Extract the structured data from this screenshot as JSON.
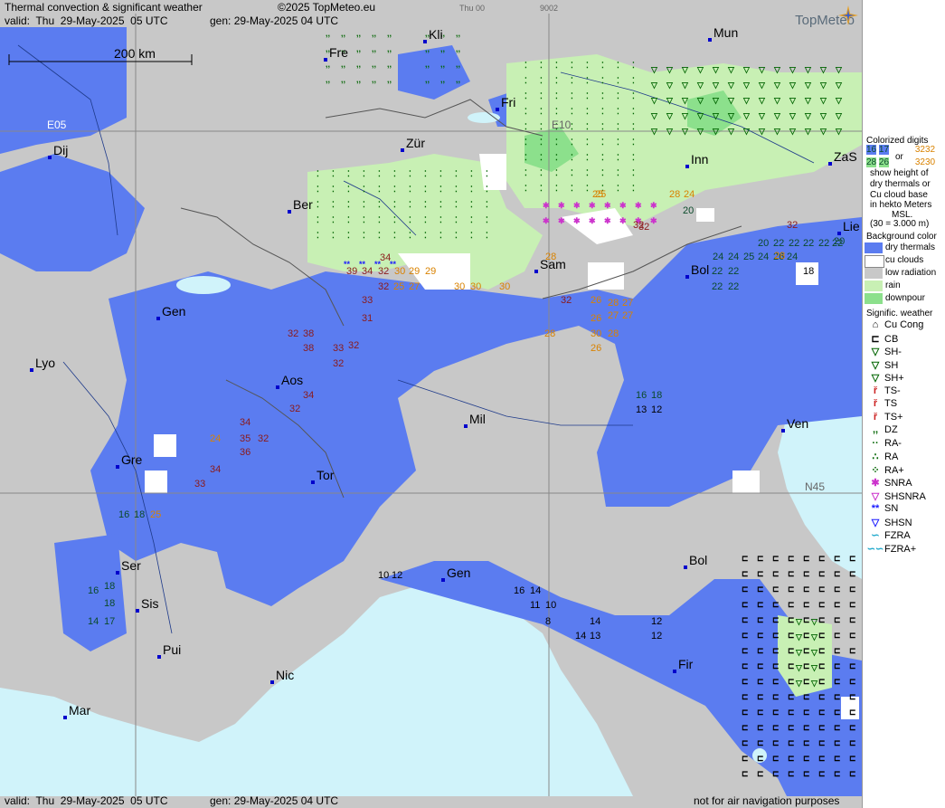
{
  "header": {
    "title": "Thermal convection & significant weather",
    "copyright": "©2025 TopMeteo.eu",
    "valid": "valid:  Thu  29-May-2025  05 UTC",
    "gen": "gen: 29-May-2025 04 UTC",
    "day_code": "Thu 00",
    "code": "9002",
    "brand": "TopMeteo",
    "scale": "200 km"
  },
  "footer": {
    "valid": "valid:  Thu  29-May-2025  05 UTC",
    "gen": "gen: 29-May-2025 04 UTC",
    "note": "not for air navigation purposes"
  },
  "grid_labels": {
    "e05": "E05",
    "e10": "E10",
    "n45": "N45"
  },
  "cities": [
    {
      "id": "kli",
      "name": "Kli"
    },
    {
      "id": "mun",
      "name": "Mun"
    },
    {
      "id": "fre",
      "name": "Fre"
    },
    {
      "id": "fri",
      "name": "Fri"
    },
    {
      "id": "dij",
      "name": "Dij"
    },
    {
      "id": "zur",
      "name": "Zür"
    },
    {
      "id": "inn",
      "name": "Inn"
    },
    {
      "id": "zas",
      "name": "ZaS"
    },
    {
      "id": "ber",
      "name": "Ber"
    },
    {
      "id": "lie",
      "name": "Lie"
    },
    {
      "id": "sam",
      "name": "Sam"
    },
    {
      "id": "bol1",
      "name": "Bol"
    },
    {
      "id": "gen1",
      "name": "Gen"
    },
    {
      "id": "lyo",
      "name": "Lyo"
    },
    {
      "id": "aos",
      "name": "Aos"
    },
    {
      "id": "mil",
      "name": "Mil"
    },
    {
      "id": "ven",
      "name": "Ven"
    },
    {
      "id": "gre",
      "name": "Gre"
    },
    {
      "id": "tor",
      "name": "Tor"
    },
    {
      "id": "ser",
      "name": "Ser"
    },
    {
      "id": "gen2",
      "name": "Gen"
    },
    {
      "id": "bol2",
      "name": "Bol"
    },
    {
      "id": "sis",
      "name": "Sis"
    },
    {
      "id": "pui",
      "name": "Pui"
    },
    {
      "id": "nic",
      "name": "Nic"
    },
    {
      "id": "fir",
      "name": "Fir"
    },
    {
      "id": "mar",
      "name": "Mar"
    }
  ],
  "thermal_numbers": [
    {
      "t": "39",
      "c": "#8b1a1a"
    },
    {
      "t": "34",
      "c": "#8b1a1a"
    },
    {
      "t": "32",
      "c": "#8b1a1a"
    },
    {
      "t": "30",
      "c": "#d98200"
    },
    {
      "t": "29",
      "c": "#d98200"
    },
    {
      "t": "30",
      "c": "#d98200"
    },
    {
      "t": "30",
      "c": "#d98200"
    },
    {
      "t": "30",
      "c": "#d98200"
    },
    {
      "t": "29",
      "c": "#d98200"
    },
    {
      "t": "34",
      "c": "#8b1a1a"
    },
    {
      "t": "25",
      "c": "#d98200"
    },
    {
      "t": "27",
      "c": "#d98200"
    },
    {
      "t": "33",
      "c": "#8b1a1a"
    },
    {
      "t": "32",
      "c": "#8b1a1a"
    },
    {
      "t": "31",
      "c": "#8b1a1a"
    },
    {
      "t": "38",
      "c": "#8b1a1a"
    },
    {
      "t": "38",
      "c": "#8b1a1a"
    },
    {
      "t": "33",
      "c": "#8b1a1a"
    },
    {
      "t": "32",
      "c": "#8b1a1a"
    },
    {
      "t": "32",
      "c": "#8b1a1a"
    },
    {
      "t": "32",
      "c": "#8b1a1a"
    },
    {
      "t": "34",
      "c": "#8b1a1a"
    },
    {
      "t": "28",
      "c": "#d98200"
    },
    {
      "t": "32",
      "c": "#8b1a1a"
    },
    {
      "t": "26",
      "c": "#d98200"
    },
    {
      "t": "28",
      "c": "#d98200"
    },
    {
      "t": "27",
      "c": "#d98200"
    },
    {
      "t": "26",
      "c": "#d98200"
    },
    {
      "t": "27",
      "c": "#d98200"
    },
    {
      "t": "27",
      "c": "#d98200"
    },
    {
      "t": "30",
      "c": "#d98200"
    },
    {
      "t": "28",
      "c": "#d98200"
    },
    {
      "t": "26",
      "c": "#d98200"
    },
    {
      "t": "28",
      "c": "#d98200"
    },
    {
      "t": "32",
      "c": "#8b1a1a"
    },
    {
      "t": "28",
      "c": "#d98200"
    },
    {
      "t": "24",
      "c": "#d98200"
    },
    {
      "t": "25",
      "c": "#d98200"
    },
    {
      "t": "34",
      "c": "#8b1a1a"
    },
    {
      "t": "35",
      "c": "#8b1a1a"
    },
    {
      "t": "36",
      "c": "#8b1a1a"
    },
    {
      "t": "32",
      "c": "#8b1a1a"
    },
    {
      "t": "24",
      "c": "#d98200"
    },
    {
      "t": "34",
      "c": "#8b1a1a"
    },
    {
      "t": "33",
      "c": "#8b1a1a"
    },
    {
      "t": "32",
      "c": "#8b1a1a"
    },
    {
      "t": "16",
      "c": "#0a4a2a"
    },
    {
      "t": "18",
      "c": "#0a4a2a"
    },
    {
      "t": "25",
      "c": "#d98200"
    },
    {
      "t": "16",
      "c": "#0a4a2a"
    },
    {
      "t": "18",
      "c": "#0a4a2a"
    },
    {
      "t": "18",
      "c": "#0a4a2a"
    },
    {
      "t": "14",
      "c": "#0a4a2a"
    },
    {
      "t": "17",
      "c": "#0a4a2a"
    },
    {
      "t": "10",
      "c": "#000"
    },
    {
      "t": "12",
      "c": "#000"
    },
    {
      "t": "16",
      "c": "#000"
    },
    {
      "t": "14",
      "c": "#000"
    },
    {
      "t": "11",
      "c": "#000"
    },
    {
      "t": "10",
      "c": "#000"
    },
    {
      "t": "8",
      "c": "#000"
    },
    {
      "t": "14",
      "c": "#000"
    },
    {
      "t": "14",
      "c": "#000"
    },
    {
      "t": "13",
      "c": "#000"
    },
    {
      "t": "12",
      "c": "#000"
    },
    {
      "t": "12",
      "c": "#000"
    },
    {
      "t": "16",
      "c": "#0a4a2a"
    },
    {
      "t": "18",
      "c": "#0a4a2a"
    },
    {
      "t": "13",
      "c": "#000"
    },
    {
      "t": "12",
      "c": "#000"
    },
    {
      "t": "20",
      "c": "#0a4a2a"
    },
    {
      "t": "20",
      "c": "#0a4a2a"
    },
    {
      "t": "22",
      "c": "#0a4a2a"
    },
    {
      "t": "22",
      "c": "#0a4a2a"
    },
    {
      "t": "22",
      "c": "#0a4a2a"
    },
    {
      "t": "22",
      "c": "#0a4a2a"
    },
    {
      "t": "22",
      "c": "#0a4a2a"
    },
    {
      "t": "20",
      "c": "#0a4a2a"
    },
    {
      "t": "18",
      "c": "#000"
    },
    {
      "t": "22",
      "c": "#0a4a2a"
    },
    {
      "t": "22",
      "c": "#0a4a2a"
    },
    {
      "t": "24",
      "c": "#0a4a2a"
    },
    {
      "t": "24",
      "c": "#0a4a2a"
    },
    {
      "t": "25",
      "c": "#0a4a2a"
    },
    {
      "t": "24",
      "c": "#0a4a2a"
    },
    {
      "t": "26",
      "c": "#0a4a2a"
    },
    {
      "t": "28",
      "c": "#d98200"
    },
    {
      "t": "24",
      "c": "#0a4a2a"
    },
    {
      "t": "25",
      "c": "#d98200"
    },
    {
      "t": "32",
      "c": "#8b1a1a"
    },
    {
      "t": "32",
      "c": "#8b1a1a"
    },
    {
      "t": "22",
      "c": "#0a4a2a"
    },
    {
      "t": "22",
      "c": "#0a4a2a"
    }
  ],
  "legend": {
    "colorized_title": [
      "Colorized digits"
    ],
    "colorized_sample_a": [
      "16",
      "17",
      "32",
      "32"
    ],
    "colorized_or": "or",
    "colorized_sample_b": [
      "28",
      "26",
      "32",
      "30"
    ],
    "colorized_desc": [
      "show height of",
      "dry thermals or",
      "Cu cloud base",
      "in hekto Meters",
      "MSL.",
      "(30 = 3.000 m)"
    ],
    "background_title": "Background color",
    "background_items": [
      {
        "label": "dry thermals",
        "color": "#5b7cf0"
      },
      {
        "label": "cu clouds",
        "color": "#ffffff"
      },
      {
        "label": "low radiation",
        "color": "#c8c8c8"
      },
      {
        "label": "rain",
        "color": "#c8f0b4"
      },
      {
        "label": "downpour",
        "color": "#8ce08c"
      }
    ],
    "weather_title": "Signific. weather",
    "weather_items": [
      {
        "sym": "⌂",
        "label": "Cu Cong",
        "color": "#000"
      },
      {
        "sym": "⊏",
        "label": "CB",
        "color": "#000"
      },
      {
        "sym": "▽",
        "label": "SH-",
        "color": "#006400"
      },
      {
        "sym": "▽",
        "label": "SH",
        "color": "#006400"
      },
      {
        "sym": "▽",
        "label": "SH+",
        "color": "#006400"
      },
      {
        "sym": "ř",
        "label": "TS-",
        "color": "#cc2222"
      },
      {
        "sym": "ř",
        "label": "TS",
        "color": "#cc2222"
      },
      {
        "sym": "ř",
        "label": "TS+",
        "color": "#cc2222"
      },
      {
        "sym": ",,",
        "label": "DZ",
        "color": "#006400"
      },
      {
        "sym": "··",
        "label": "RA-",
        "color": "#006400"
      },
      {
        "sym": "∴",
        "label": "RA",
        "color": "#006400"
      },
      {
        "sym": "⁘",
        "label": "RA+",
        "color": "#006400"
      },
      {
        "sym": "✱",
        "label": "SNRA",
        "color": "#cc33cc"
      },
      {
        "sym": "▽",
        "label": "SHSNRA",
        "color": "#cc33cc"
      },
      {
        "sym": "**",
        "label": "SN",
        "color": "#1a1aff"
      },
      {
        "sym": "▽",
        "label": "SHSN",
        "color": "#1a1aff"
      },
      {
        "sym": "∽",
        "label": "FZRA",
        "color": "#22aacc"
      },
      {
        "sym": "∽∽",
        "label": "FZRA+",
        "color": "#22aacc"
      }
    ]
  },
  "colors": {
    "sea": "#d0f3fa",
    "land": "#c8c8c8",
    "thermal": "#5b7cf0",
    "rain": "#c8f0b4",
    "downpour": "#8ce08c"
  }
}
